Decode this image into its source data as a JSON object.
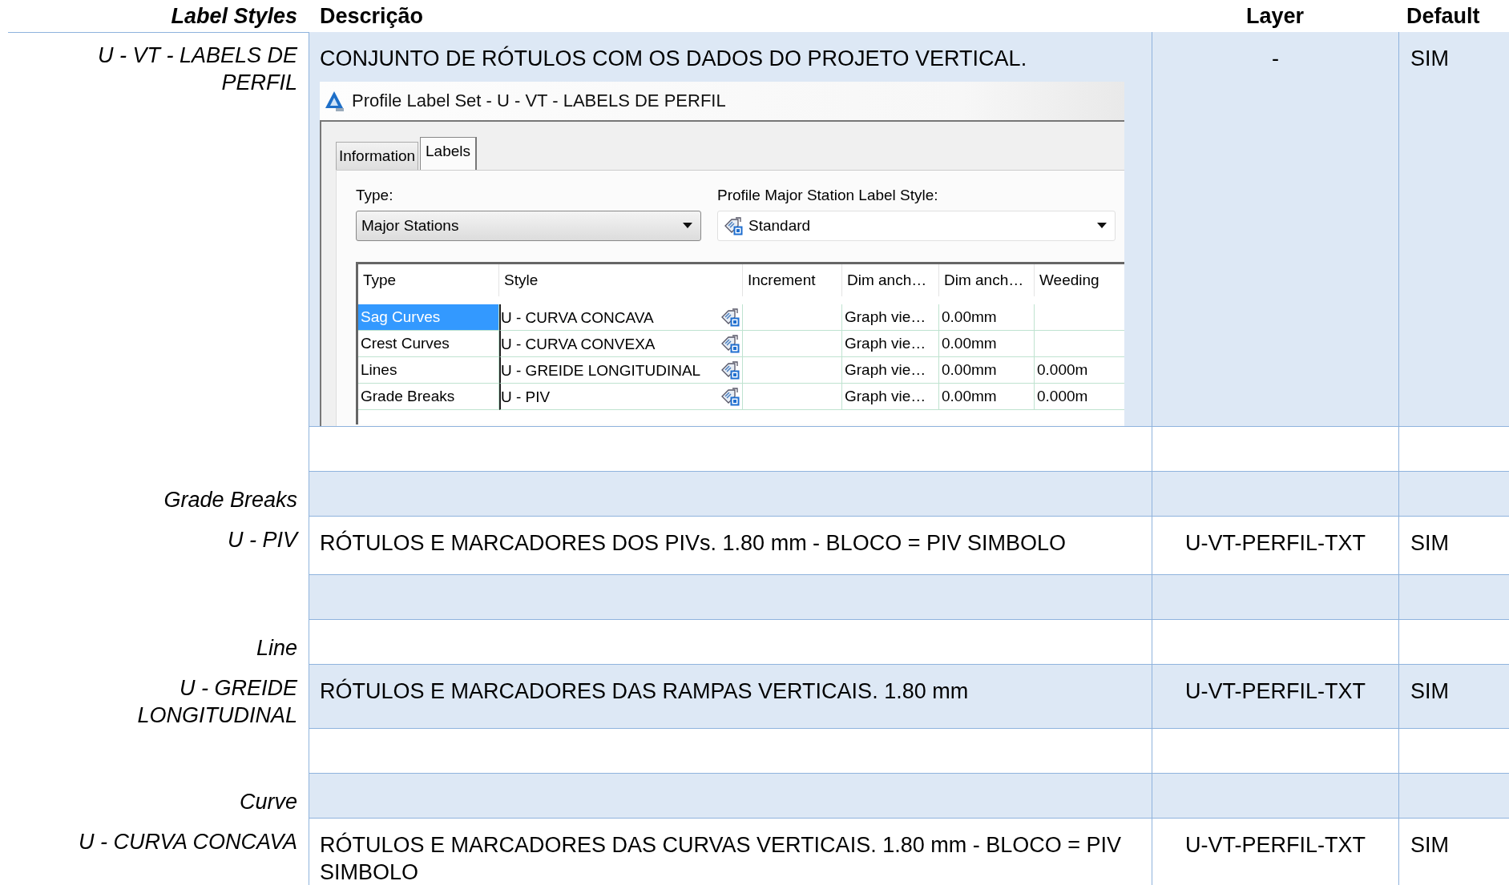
{
  "table": {
    "columns": [
      "Label Styles",
      "Descrição",
      "Layer",
      "Default"
    ],
    "rows": [
      {
        "kind": "style",
        "label": "U - VT - LABELS DE PERFIL",
        "description": "CONJUNTO DE RÓTULOS COM OS DADOS DO PROJETO VERTICAL.",
        "layer": "-",
        "default": "SIM",
        "dialog": {
          "title": "Profile Label Set - U - VT - LABELS DE PERFIL",
          "tabs": [
            {
              "label": "Information",
              "selected": false
            },
            {
              "label": "Labels",
              "selected": true
            }
          ],
          "type_label": "Type:",
          "type_value": "Major Stations",
          "style_label": "Profile Major Station Label Style:",
          "style_value": "Standard",
          "grid_columns": [
            "Type",
            "Style",
            "Increment",
            "Dim anch…",
            "Dim anch…",
            "Weeding"
          ],
          "grid_rows": [
            {
              "type": "Sag Curves",
              "style": "U - CURVA CONCAVA",
              "dim_1": "Graph vie…",
              "dim_2": "0.00mm",
              "selected": true
            },
            {
              "type": "Crest Curves",
              "style": "U - CURVA CONVEXA",
              "dim_1": "Graph vie…",
              "dim_2": "0.00mm",
              "selected": false
            },
            {
              "type": "Lines",
              "style": "U - GREIDE LONGITUDINAL",
              "dim_1": "Graph vie…",
              "dim_2": "0.00mm",
              "weeding": "0.000m",
              "selected": false
            },
            {
              "type": "Grade Breaks",
              "style": "U - PIV",
              "dim_1": "Graph vie…",
              "dim_2": "0.00mm",
              "weeding": "0.000m",
              "selected": false
            }
          ]
        }
      },
      {
        "kind": "blank"
      },
      {
        "kind": "section",
        "label": "Grade Breaks"
      },
      {
        "kind": "style",
        "label": "U - PIV",
        "description": "RÓTULOS E MARCADORES DOS PIVs. 1.80 mm - BLOCO = PIV SIMBOLO",
        "layer": "U-VT-PERFIL-TXT",
        "default": "SIM"
      },
      {
        "kind": "blank"
      },
      {
        "kind": "section",
        "label": "Line"
      },
      {
        "kind": "style",
        "label": "U - GREIDE LONGITUDINAL",
        "description": "RÓTULOS E MARCADORES DAS RAMPAS VERTICAIS. 1.80 mm",
        "layer": "U-VT-PERFIL-TXT",
        "default": "SIM"
      },
      {
        "kind": "blank"
      },
      {
        "kind": "section",
        "label": "Curve"
      },
      {
        "kind": "style",
        "label": "U - CURVA CONCAVA",
        "description": "RÓTULOS E MARCADORES DAS CURVAS VERTICAIS.  1.80 mm - BLOCO = PIV SIMBOLO",
        "layer": "U-VT-PERFIL-TXT",
        "default": "SIM"
      }
    ]
  }
}
